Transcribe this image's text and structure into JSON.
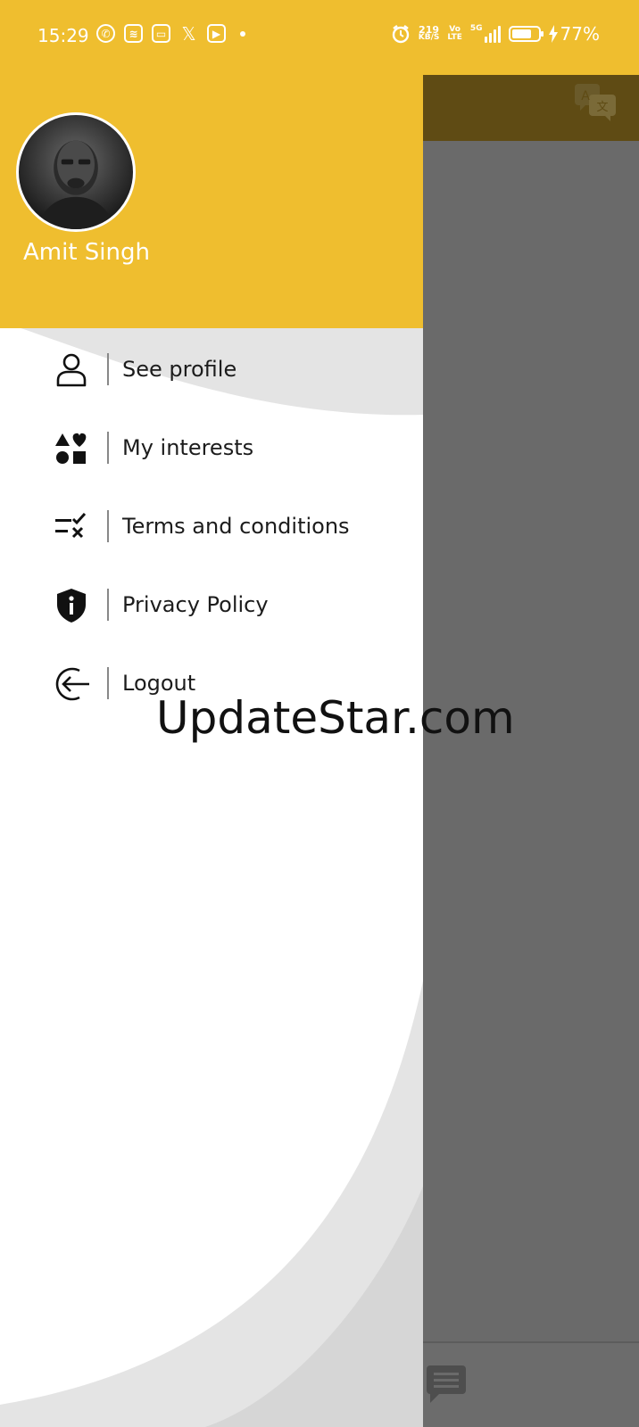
{
  "status_bar": {
    "time": "15:29",
    "net_speed_value": "219",
    "net_speed_unit": "KB/S",
    "volte_top": "Vo",
    "volte_bottom": "LTE",
    "network": "5G",
    "battery_level": 0.77,
    "battery_percent": "77%"
  },
  "drawer": {
    "user_name": "Amit Singh",
    "menu": [
      {
        "label": "See profile",
        "icon": "person-icon"
      },
      {
        "label": "My interests",
        "icon": "interests-shapes-icon"
      },
      {
        "label": "Terms and conditions",
        "icon": "checklist-icon"
      },
      {
        "label": "Privacy Policy",
        "icon": "shield-info-icon"
      },
      {
        "label": "Logout",
        "icon": "logout-icon"
      }
    ]
  },
  "watermark": "UpdateStar.com",
  "colors": {
    "accent": "#efbe2f",
    "scrim": "#6a6a6a"
  }
}
